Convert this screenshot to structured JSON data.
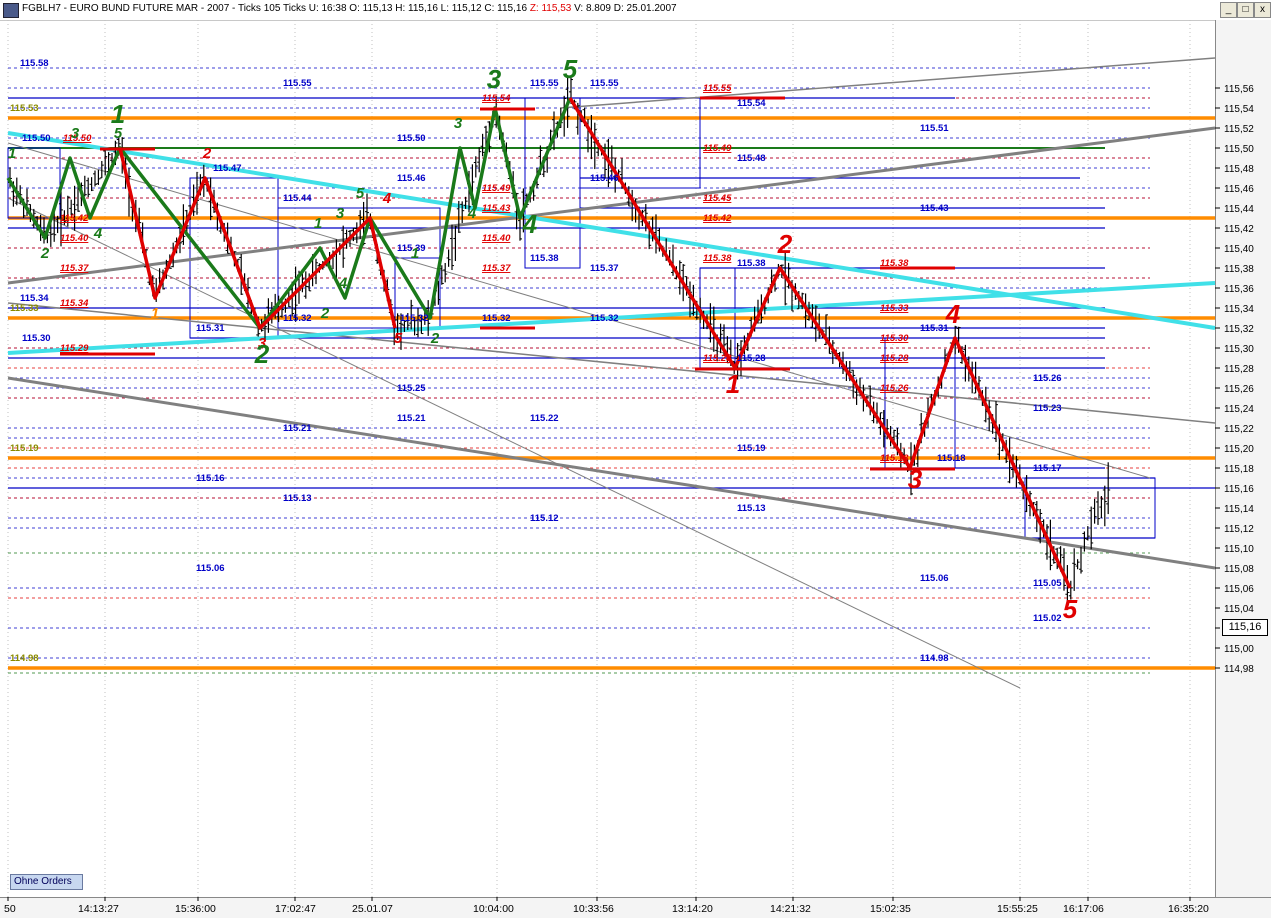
{
  "window": {
    "title_main": "FGBLH7 - EURO BUND FUTURE  MAR - 2007 - Ticks 105 Ticks U: 16:38  O: 115,13  H: 115,16  L: 115,12  C: 115,16",
    "title_z": "Z: 115,53",
    "title_tail": "V: 8.809  D: 25.01.2007",
    "buttons": [
      "_",
      "□",
      "x"
    ]
  },
  "toolbar": {
    "ohne_orders": "Ohne Orders"
  },
  "colors": {
    "green": "#1a7a1a",
    "red": "#e00000",
    "blue": "#0000c8",
    "orange": "#ff8c00",
    "cyan": "#40e0e8",
    "gray": "#808080"
  },
  "chart_data": {
    "type": "bar",
    "instrument": "FGBLH7",
    "ylim": [
      114.96,
      115.57
    ],
    "y_ticks": [
      "115,56",
      "115,54",
      "115,52",
      "115,50",
      "115,48",
      "115,46",
      "115,44",
      "115,42",
      "115,40",
      "115,38",
      "115,36",
      "115,34",
      "115,32",
      "115,30",
      "115,28",
      "115,26",
      "115,24",
      "115,22",
      "115,20",
      "115,18",
      "115,16",
      "115,14",
      "115,12",
      "115,10",
      "115,08",
      "115,06",
      "115,04",
      "115,02",
      "115,00",
      "114,98"
    ],
    "last_price_label": "115,16",
    "last_price": 115.16,
    "x_ticks": [
      "50",
      "14:13:27",
      "15:36:00",
      "17:02:47",
      "25.01.07",
      "10:04:00",
      "10:33:56",
      "13:14:20",
      "14:21:32",
      "15:02:35",
      "15:55:25",
      "16:17:06",
      "16:35:20"
    ],
    "price_path": [
      [
        8,
        115.47
      ],
      [
        45,
        115.41
      ],
      [
        120,
        115.5
      ],
      [
        155,
        115.35
      ],
      [
        205,
        115.47
      ],
      [
        260,
        115.32
      ],
      [
        370,
        115.43
      ],
      [
        395,
        115.32
      ],
      [
        430,
        115.33
      ],
      [
        495,
        115.54
      ],
      [
        520,
        115.43
      ],
      [
        570,
        115.55
      ],
      [
        735,
        115.28
      ],
      [
        780,
        115.38
      ],
      [
        910,
        115.18
      ],
      [
        955,
        115.31
      ],
      [
        1070,
        115.06
      ],
      [
        1090,
        115.12
      ],
      [
        1110,
        115.16
      ]
    ],
    "green_wave": [
      [
        8,
        115.47
      ],
      [
        45,
        115.41
      ],
      [
        70,
        115.49
      ],
      [
        90,
        115.43
      ],
      [
        120,
        115.5
      ],
      [
        260,
        115.32
      ],
      [
        320,
        115.4
      ],
      [
        345,
        115.35
      ],
      [
        370,
        115.43
      ],
      [
        430,
        115.33
      ],
      [
        460,
        115.5
      ],
      [
        475,
        115.44
      ],
      [
        495,
        115.54
      ],
      [
        520,
        115.43
      ],
      [
        570,
        115.55
      ]
    ],
    "red_waves": [
      [
        [
          120,
          115.5
        ],
        [
          155,
          115.35
        ],
        [
          205,
          115.47
        ],
        [
          260,
          115.32
        ],
        [
          370,
          115.43
        ],
        [
          395,
          115.32
        ]
      ],
      [
        [
          570,
          115.55
        ],
        [
          735,
          115.28
        ],
        [
          780,
          115.38
        ],
        [
          910,
          115.18
        ],
        [
          955,
          115.31
        ],
        [
          1070,
          115.06
        ]
      ]
    ],
    "wave_labels": [
      {
        "text": "1",
        "x": 12,
        "y": 115.49,
        "color": "green"
      },
      {
        "text": "2",
        "x": 45,
        "y": 115.39,
        "color": "green"
      },
      {
        "text": "3",
        "x": 75,
        "y": 115.51,
        "color": "green"
      },
      {
        "text": "4",
        "x": 98,
        "y": 115.41,
        "color": "green"
      },
      {
        "text": "5",
        "x": 118,
        "y": 115.51,
        "color": "green"
      },
      {
        "text": "1",
        "x": 118,
        "y": 115.525,
        "color": "green",
        "big": true
      },
      {
        "text": "2",
        "x": 207,
        "y": 115.49,
        "color": "red"
      },
      {
        "text": "1",
        "x": 155,
        "y": 115.33,
        "color": "orange"
      },
      {
        "text": "3",
        "x": 262,
        "y": 115.3,
        "color": "red"
      },
      {
        "text": "2",
        "x": 262,
        "y": 115.285,
        "color": "green",
        "big": true
      },
      {
        "text": "1",
        "x": 318,
        "y": 115.42,
        "color": "green"
      },
      {
        "text": "2",
        "x": 325,
        "y": 115.33,
        "color": "green"
      },
      {
        "text": "3",
        "x": 340,
        "y": 115.43,
        "color": "green"
      },
      {
        "text": "4",
        "x": 343,
        "y": 115.36,
        "color": "green"
      },
      {
        "text": "5",
        "x": 360,
        "y": 115.45,
        "color": "green"
      },
      {
        "text": "4",
        "x": 387,
        "y": 115.445,
        "color": "red"
      },
      {
        "text": "5",
        "x": 398,
        "y": 115.305,
        "color": "red"
      },
      {
        "text": "1",
        "x": 415,
        "y": 115.39,
        "color": "green"
      },
      {
        "text": "2",
        "x": 435,
        "y": 115.305,
        "color": "green"
      },
      {
        "text": "3",
        "x": 458,
        "y": 115.52,
        "color": "green"
      },
      {
        "text": "4",
        "x": 472,
        "y": 115.43,
        "color": "green"
      },
      {
        "text": "3",
        "x": 494,
        "y": 115.56,
        "color": "green",
        "big": true
      },
      {
        "text": "4",
        "x": 530,
        "y": 115.415,
        "color": "green",
        "big": true
      },
      {
        "text": "5",
        "x": 570,
        "y": 115.57,
        "color": "green",
        "big": true
      },
      {
        "text": "1",
        "x": 733,
        "y": 115.255,
        "color": "red",
        "big": true
      },
      {
        "text": "2",
        "x": 785,
        "y": 115.395,
        "color": "red",
        "big": true
      },
      {
        "text": "3",
        "x": 915,
        "y": 115.16,
        "color": "red",
        "big": true
      },
      {
        "text": "4",
        "x": 953,
        "y": 115.325,
        "color": "red",
        "big": true
      },
      {
        "text": "5",
        "x": 1070,
        "y": 115.03,
        "color": "red",
        "big": true
      }
    ],
    "level_labels": [
      {
        "text": "115.58",
        "x": 20,
        "y": 115.58,
        "color": "blue"
      },
      {
        "text": "115.55",
        "x": 283,
        "y": 115.56,
        "color": "blue"
      },
      {
        "text": "115.53",
        "x": 10,
        "y": 115.535,
        "color": "olive"
      },
      {
        "text": "115.50",
        "x": 22,
        "y": 115.505,
        "color": "blue"
      },
      {
        "text": "115.50",
        "x": 63,
        "y": 115.505,
        "color": "red"
      },
      {
        "text": "115.50",
        "x": 397,
        "y": 115.505,
        "color": "blue"
      },
      {
        "text": "115.47",
        "x": 213,
        "y": 115.475,
        "color": "blue"
      },
      {
        "text": "115.46",
        "x": 397,
        "y": 115.465,
        "color": "blue"
      },
      {
        "text": "115.44",
        "x": 283,
        "y": 115.445,
        "color": "blue"
      },
      {
        "text": "115.42",
        "x": 60,
        "y": 115.425,
        "color": "red"
      },
      {
        "text": "115.40",
        "x": 60,
        "y": 115.405,
        "color": "red"
      },
      {
        "text": "115.39",
        "x": 397,
        "y": 115.395,
        "color": "blue"
      },
      {
        "text": "115.37",
        "x": 60,
        "y": 115.375,
        "color": "red"
      },
      {
        "text": "115.34",
        "x": 20,
        "y": 115.345,
        "color": "blue"
      },
      {
        "text": "115.34",
        "x": 60,
        "y": 115.34,
        "color": "red"
      },
      {
        "text": "115.33",
        "x": 10,
        "y": 115.335,
        "color": "olive"
      },
      {
        "text": "115.31",
        "x": 196,
        "y": 115.315,
        "color": "blue"
      },
      {
        "text": "115.32",
        "x": 283,
        "y": 115.325,
        "color": "blue"
      },
      {
        "text": "115.32",
        "x": 400,
        "y": 115.325,
        "color": "blue"
      },
      {
        "text": "115.30",
        "x": 22,
        "y": 115.305,
        "color": "blue"
      },
      {
        "text": "115.29",
        "x": 60,
        "y": 115.295,
        "color": "red"
      },
      {
        "text": "115.25",
        "x": 397,
        "y": 115.255,
        "color": "blue"
      },
      {
        "text": "115.21",
        "x": 283,
        "y": 115.215,
        "color": "blue"
      },
      {
        "text": "115.21",
        "x": 397,
        "y": 115.225,
        "color": "blue"
      },
      {
        "text": "115.19",
        "x": 10,
        "y": 115.195,
        "color": "olive"
      },
      {
        "text": "115.16",
        "x": 196,
        "y": 115.165,
        "color": "blue"
      },
      {
        "text": "115.13",
        "x": 283,
        "y": 115.145,
        "color": "blue"
      },
      {
        "text": "115.06",
        "x": 196,
        "y": 115.075,
        "color": "blue"
      },
      {
        "text": "114.98",
        "x": 10,
        "y": 114.985,
        "color": "olive"
      },
      {
        "text": "115.55",
        "x": 530,
        "y": 115.56,
        "color": "blue"
      },
      {
        "text": "115.55",
        "x": 590,
        "y": 115.56,
        "color": "blue"
      },
      {
        "text": "115.54",
        "x": 482,
        "y": 115.545,
        "color": "red"
      },
      {
        "text": "115.49",
        "x": 482,
        "y": 115.455,
        "color": "red"
      },
      {
        "text": "115.43",
        "x": 482,
        "y": 115.435,
        "color": "red"
      },
      {
        "text": "115.40",
        "x": 482,
        "y": 115.405,
        "color": "red"
      },
      {
        "text": "115.37",
        "x": 482,
        "y": 115.375,
        "color": "red"
      },
      {
        "text": "115.38",
        "x": 530,
        "y": 115.385,
        "color": "blue"
      },
      {
        "text": "115.37",
        "x": 590,
        "y": 115.375,
        "color": "blue"
      },
      {
        "text": "115.32",
        "x": 482,
        "y": 115.325,
        "color": "blue"
      },
      {
        "text": "115.32",
        "x": 590,
        "y": 115.325,
        "color": "blue"
      },
      {
        "text": "115.22",
        "x": 530,
        "y": 115.225,
        "color": "blue"
      },
      {
        "text": "115.12",
        "x": 530,
        "y": 115.125,
        "color": "blue"
      },
      {
        "text": "115.46",
        "x": 590,
        "y": 115.465,
        "color": "blue"
      },
      {
        "text": "115.55",
        "x": 703,
        "y": 115.555,
        "color": "red"
      },
      {
        "text": "115.54",
        "x": 737,
        "y": 115.54,
        "color": "blue"
      },
      {
        "text": "115.51",
        "x": 920,
        "y": 115.515,
        "color": "blue"
      },
      {
        "text": "115.49",
        "x": 703,
        "y": 115.495,
        "color": "red"
      },
      {
        "text": "115.48",
        "x": 737,
        "y": 115.485,
        "color": "blue"
      },
      {
        "text": "115.45",
        "x": 703,
        "y": 115.445,
        "color": "red"
      },
      {
        "text": "115.43",
        "x": 920,
        "y": 115.435,
        "color": "blue"
      },
      {
        "text": "115.42",
        "x": 703,
        "y": 115.425,
        "color": "red"
      },
      {
        "text": "115.38",
        "x": 703,
        "y": 115.385,
        "color": "red"
      },
      {
        "text": "115.38",
        "x": 737,
        "y": 115.38,
        "color": "blue"
      },
      {
        "text": "115.38",
        "x": 880,
        "y": 115.38,
        "color": "red"
      },
      {
        "text": "115.33",
        "x": 880,
        "y": 115.335,
        "color": "red"
      },
      {
        "text": "115.31",
        "x": 920,
        "y": 115.315,
        "color": "blue"
      },
      {
        "text": "115.30",
        "x": 880,
        "y": 115.305,
        "color": "red"
      },
      {
        "text": "115.28",
        "x": 703,
        "y": 115.285,
        "color": "red"
      },
      {
        "text": "115.28",
        "x": 737,
        "y": 115.285,
        "color": "blue"
      },
      {
        "text": "115.28",
        "x": 880,
        "y": 115.285,
        "color": "red"
      },
      {
        "text": "115.26",
        "x": 880,
        "y": 115.255,
        "color": "red"
      },
      {
        "text": "115.26",
        "x": 1033,
        "y": 115.265,
        "color": "blue"
      },
      {
        "text": "115.23",
        "x": 1033,
        "y": 115.235,
        "color": "blue"
      },
      {
        "text": "115.19",
        "x": 737,
        "y": 115.195,
        "color": "blue"
      },
      {
        "text": "115.18",
        "x": 880,
        "y": 115.185,
        "color": "red"
      },
      {
        "text": "115.18",
        "x": 937,
        "y": 115.185,
        "color": "blue"
      },
      {
        "text": "115.17",
        "x": 1033,
        "y": 115.175,
        "color": "blue"
      },
      {
        "text": "115.13",
        "x": 737,
        "y": 115.135,
        "color": "blue"
      },
      {
        "text": "115.06",
        "x": 920,
        "y": 115.065,
        "color": "blue"
      },
      {
        "text": "115.05",
        "x": 1033,
        "y": 115.06,
        "color": "blue"
      },
      {
        "text": "115.02",
        "x": 1033,
        "y": 115.025,
        "color": "blue"
      },
      {
        "text": "114.98",
        "x": 920,
        "y": 114.985,
        "color": "blue"
      }
    ],
    "orange_levels": [
      115.53,
      115.43,
      115.33,
      115.19,
      114.98
    ],
    "blue_solid_levels": [
      {
        "y": 115.55,
        "x1": 8,
        "x2": 955
      },
      {
        "y": 115.47,
        "x1": 580,
        "x2": 1080
      },
      {
        "y": 115.44,
        "x1": 580,
        "x2": 1105
      },
      {
        "y": 115.42,
        "x1": 8,
        "x2": 1105
      },
      {
        "y": 115.38,
        "x1": 700,
        "x2": 1105
      },
      {
        "y": 115.34,
        "x1": 8,
        "x2": 1105
      },
      {
        "y": 115.32,
        "x1": 700,
        "x2": 1105
      },
      {
        "y": 115.31,
        "x1": 190,
        "x2": 1105
      },
      {
        "y": 115.29,
        "x1": 8,
        "x2": 1105
      },
      {
        "y": 115.28,
        "x1": 700,
        "x2": 1105
      },
      {
        "y": 115.18,
        "x1": 870,
        "x2": 1105
      },
      {
        "y": 115.17,
        "x1": 1025,
        "x2": 1155
      },
      {
        "y": 115.16,
        "x1": 8,
        "x2": 1215
      },
      {
        "y": 115.11,
        "x1": 1025,
        "x2": 1155
      }
    ],
    "blue_dashed_levels": [
      115.58,
      115.56,
      115.55,
      115.54,
      115.53,
      115.51,
      115.49,
      115.48,
      115.46,
      115.45,
      115.4,
      115.37,
      115.36,
      115.3,
      115.27,
      115.26,
      115.25,
      115.22,
      115.21,
      115.17,
      115.15,
      115.13,
      115.12,
      115.06,
      115.02,
      114.99
    ],
    "red_dashed_levels": [
      115.55,
      115.49,
      115.45,
      115.4,
      115.37,
      115.33,
      115.3,
      115.28,
      115.25,
      115.2,
      115.18,
      115.15,
      115.05
    ],
    "green_solid_levels": [
      {
        "y": 115.5,
        "x1": 8,
        "x2": 1105
      }
    ],
    "gray_trendlines": [
      {
        "x1": 8,
        "y1": 115.365,
        "x2": 1215,
        "y2": 115.52,
        "width": 3
      },
      {
        "x1": 8,
        "y1": 115.27,
        "x2": 1215,
        "y2": 115.08,
        "width": 3
      },
      {
        "x1": 560,
        "y1": 115.54,
        "x2": 1215,
        "y2": 115.59,
        "width": 1.5
      },
      {
        "x1": 8,
        "y1": 115.345,
        "x2": 1215,
        "y2": 115.225,
        "width": 1.5
      },
      {
        "x1": 8,
        "y1": 115.505,
        "x2": 1150,
        "y2": 115.17,
        "width": 1
      },
      {
        "x1": 8,
        "y1": 115.45,
        "x2": 1020,
        "y2": 114.96,
        "width": 1
      }
    ],
    "cyan_trendlines": [
      {
        "x1": 8,
        "y1": 115.515,
        "x2": 1215,
        "y2": 115.32
      },
      {
        "x1": 8,
        "y1": 115.295,
        "x2": 1215,
        "y2": 115.365
      }
    ]
  }
}
